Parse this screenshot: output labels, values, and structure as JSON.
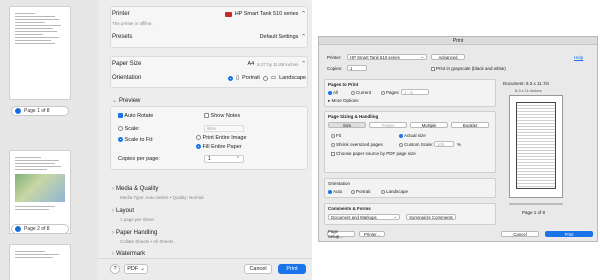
{
  "left": {
    "page_labels": [
      "Page 1 of 8",
      "Page 2 of 8"
    ],
    "printer": {
      "label": "Printer",
      "value": "HP Smart Tank 510 series",
      "status": "The printer is offline."
    },
    "presets": {
      "label": "Presets",
      "value": "Default Settings"
    },
    "paper_size": {
      "label": "Paper Size",
      "value": "A4",
      "detail": "8.27 by 11.69 inches"
    },
    "orientation": {
      "label": "Orientation",
      "portrait": "Portrait",
      "landscape": "Landscape"
    },
    "preview": {
      "title": "Preview",
      "auto_rotate": "Auto Rotate",
      "show_notes": "Show Notes",
      "scale": "Scale:",
      "scale_value": "96%",
      "scale_to_fit": "Scale to Fit:",
      "print_entire_image": "Print Entire Image",
      "fill_entire_paper": "Fill Entire Paper",
      "copies_per_page": "Copies per page:",
      "copies_per_page_value": "1"
    },
    "sections": [
      {
        "title": "Media & Quality",
        "sub": "Media Type: Auto Select • Quality: Normal"
      },
      {
        "title": "Layout",
        "sub": "1 page per sheet"
      },
      {
        "title": "Paper Handling",
        "sub": "Collate Sheets • All Sheets"
      },
      {
        "title": "Watermark",
        "sub": ""
      }
    ],
    "footer": {
      "help": "?",
      "pdf": "PDF",
      "cancel": "Cancel",
      "print": "Print"
    }
  },
  "right": {
    "title": "Print",
    "printer_label": "Printer:",
    "printer_value": "HP Smart Tank 510 series",
    "advanced": "Advanced",
    "help": "Help",
    "copies_label": "Copies:",
    "copies_value": "1",
    "grayscale": "Print in grayscale (black and white)",
    "pages": {
      "title": "Pages to Print",
      "all": "All",
      "current": "Current",
      "pages": "Pages",
      "range": "1 - 8",
      "more": "More Options"
    },
    "sizing": {
      "title": "Page Sizing & Handling",
      "tabs": [
        "Size",
        "Poster",
        "Multiple",
        "Booklet"
      ],
      "fit": "Fit",
      "actual": "Actual size",
      "shrink": "Shrink oversized pages",
      "custom": "Custom Scale:",
      "custom_value": "100",
      "percent": "%",
      "choose_source": "Choose paper source by PDF page size"
    },
    "orientation": {
      "title": "Orientation",
      "auto": "Auto",
      "portrait": "Portrait",
      "landscape": "Landscape"
    },
    "comments": {
      "title": "Comments & Forms",
      "value": "Document and Markups",
      "summarize": "Summarize Comments"
    },
    "doc_size": "Document: 8.3 x 11.7in",
    "paper_dims": "8.3 x 11 inches",
    "page_counter": "Page 1 of 8",
    "footer": {
      "page_setup": "Page Setup...",
      "printer": "Printer...",
      "cancel": "Cancel",
      "print": "Print"
    }
  },
  "colors": {
    "accent": "#1a73e8",
    "brand_icon": "#c62828"
  }
}
